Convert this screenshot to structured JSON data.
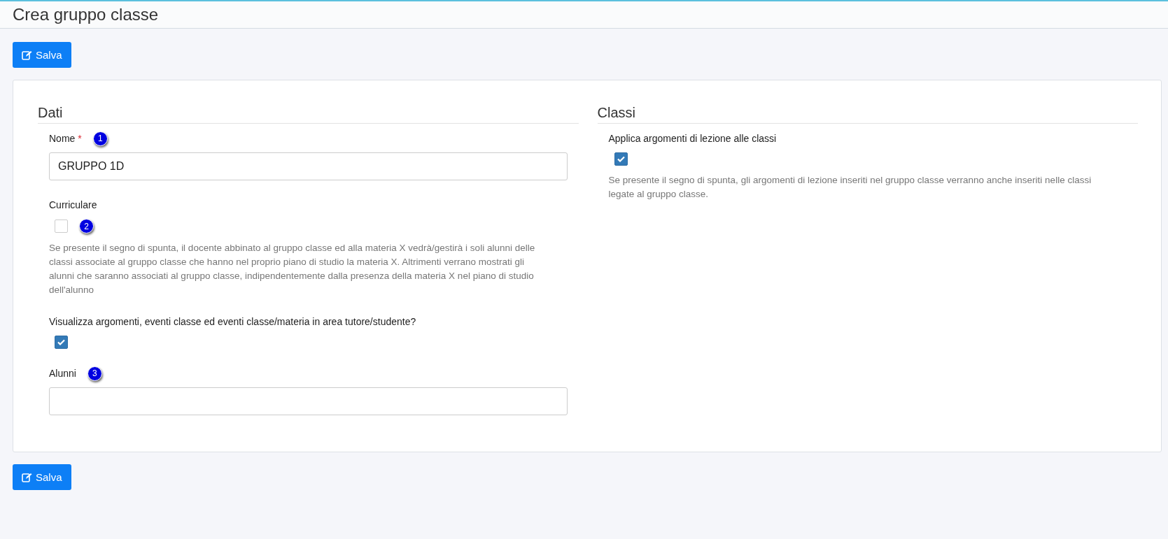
{
  "page_title": "Crea gruppo classe",
  "save_buttons": [
    "Salva",
    "Salva"
  ],
  "sections": [
    {
      "title": "Dati",
      "fields": [
        {
          "kind": "text",
          "label": "Nome",
          "required_mark": "*",
          "badge": "1",
          "value": "GRUPPO 1D"
        },
        {
          "kind": "checkbox",
          "label": "Curriculare",
          "badge": "2",
          "checked": false,
          "help": "Se presente il segno di spunta, il docente abbinato al gruppo classe ed alla materia X vedrà/gestirà i soli alunni delle classi associate al gruppo classe che hanno nel proprio piano di studio la materia X. Altrimenti verrano mostrati gli alunni che saranno associati al gruppo classe, indipendentemente dalla presenza della materia X nel piano di studio dell'alunno"
        },
        {
          "kind": "checkbox",
          "label": "Visualizza argomenti, eventi classe ed eventi classe/materia in area tutore/studente?",
          "checked": true
        },
        {
          "kind": "text",
          "label": "Alunni",
          "badge": "3"
        }
      ]
    },
    {
      "title": "Classi",
      "fields": [
        {
          "kind": "checkbox",
          "label": "Applica argomenti di lezione alle classi",
          "checked": true,
          "help": "Se presente il segno di spunta, gli argomenti di lezione inseriti nel gruppo classe verranno anche inseriti nelle classi legate al gruppo classe."
        }
      ]
    }
  ]
}
